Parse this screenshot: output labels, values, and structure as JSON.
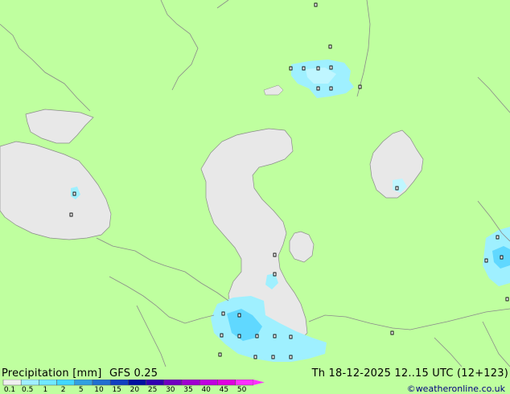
{
  "legend": {
    "title": "Precipitation [mm]",
    "model": "GFS 0.25",
    "datetime": "Th 18-12-2025 12..15 UTC (12+123)",
    "credit": "©weatheronline.co.uk",
    "labels": [
      "0.1",
      "0.5",
      "1",
      "2",
      "5",
      "10",
      "15",
      "20",
      "25",
      "30",
      "35",
      "40",
      "45",
      "50"
    ],
    "colors": [
      "#f0f0f0",
      "#a0f0ff",
      "#70e8ff",
      "#40d8ff",
      "#30a0e0",
      "#2070d0",
      "#1040c0",
      "#0010a0",
      "#3000b0",
      "#7000c0",
      "#a000d0",
      "#c000e0",
      "#e000e0",
      "#ff30ff"
    ]
  },
  "map": {
    "colors": {
      "land": "#bfff9f",
      "water": "#e8e8e8",
      "border": "#8a8a8a",
      "precip_light": "#9ff0ff",
      "precip_medium": "#60d8ff"
    },
    "precipitation_max_mm": "2"
  }
}
